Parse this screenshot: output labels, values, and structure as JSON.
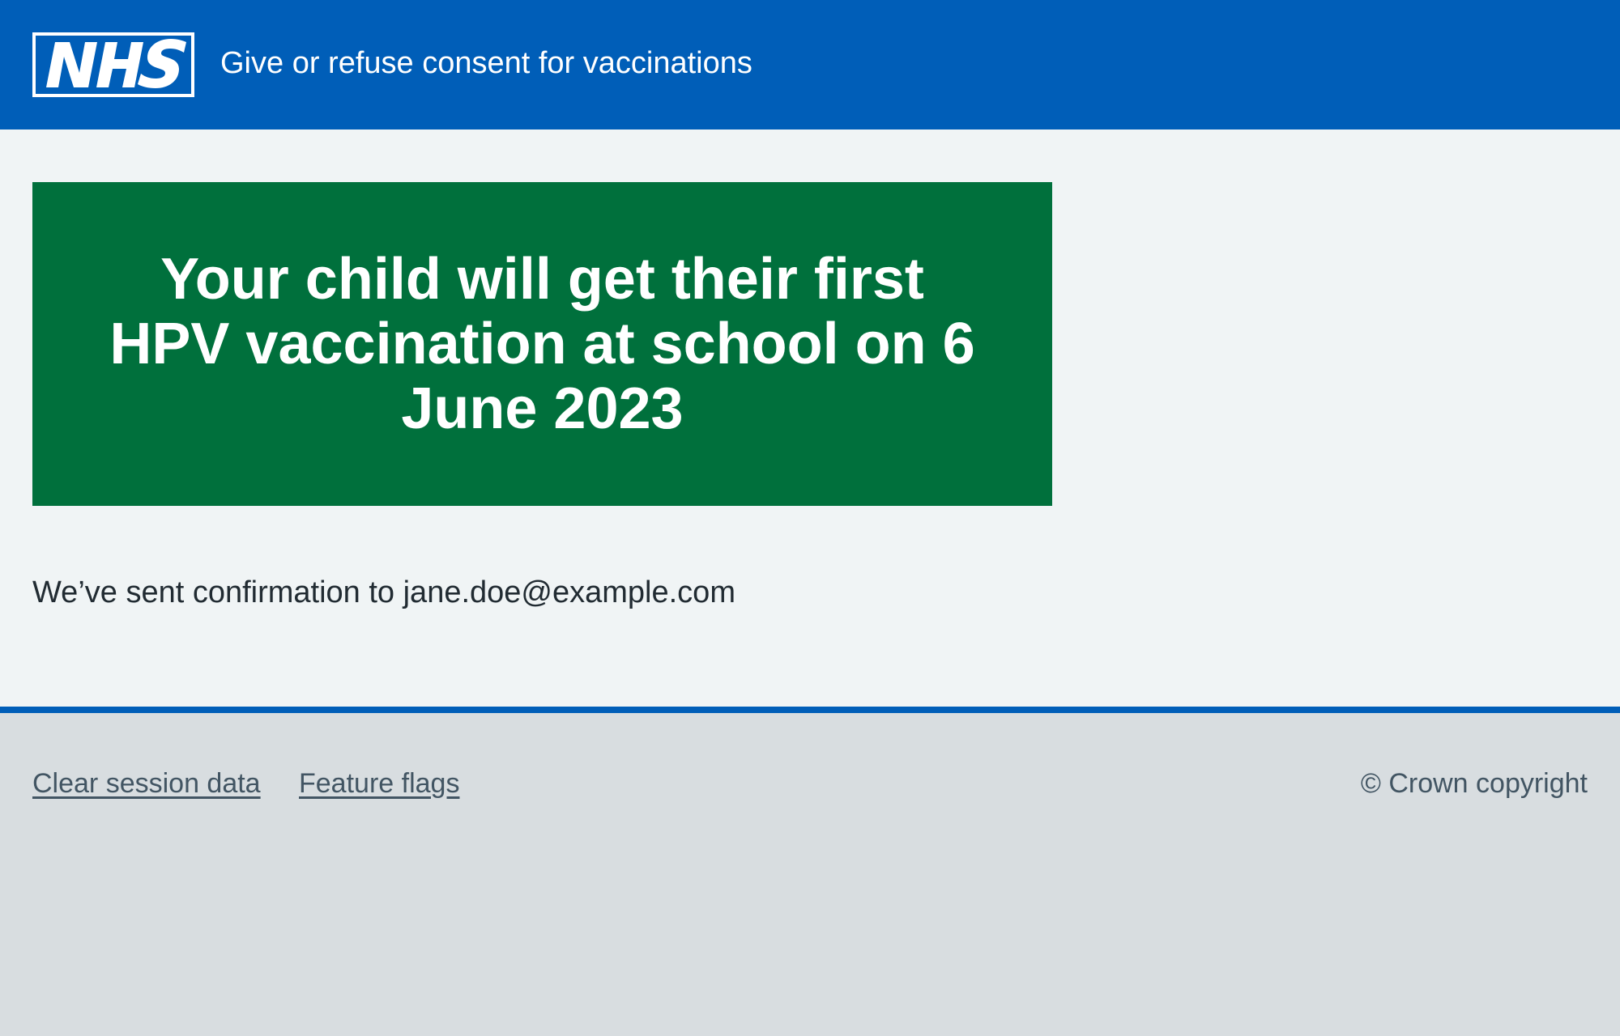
{
  "header": {
    "logo_text": "NHS",
    "service_name": "Give or refuse consent for vaccinations"
  },
  "main": {
    "panel_title": "Your child will get their first HPV vaccination at school on 6 June 2023",
    "confirmation_text": "We’ve sent confirmation to jane.doe@example.com"
  },
  "footer": {
    "links": [
      {
        "label": "Clear session data"
      },
      {
        "label": "Feature flags"
      }
    ],
    "copyright": "© Crown copyright"
  },
  "colors": {
    "header_blue": "#005eb8",
    "panel_green": "#00703c",
    "page_background": "#f0f4f5",
    "footer_background": "#d8dde0",
    "footer_text": "#425563"
  }
}
